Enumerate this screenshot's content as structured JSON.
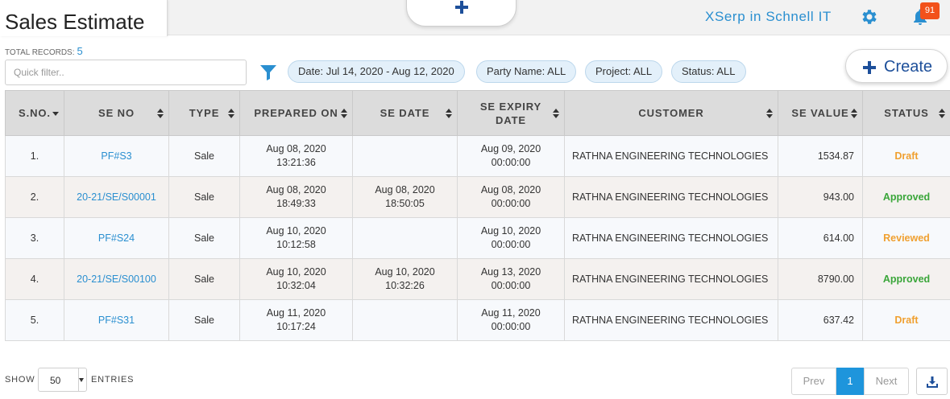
{
  "header": {
    "title": "Sales Estimate",
    "company": "XSerp in Schnell IT",
    "notification_count": "91",
    "accent": "#2a8fd0"
  },
  "toolbar": {
    "total_label": "TOTAL RECORDS:",
    "total_count": "5",
    "quick_filter_placeholder": "Quick filter..",
    "chips": [
      {
        "label": "Date:",
        "value": "Jul 14, 2020 - Aug 12, 2020"
      },
      {
        "label": "Party Name:",
        "value": "ALL"
      },
      {
        "label": "Project:",
        "value": "ALL"
      },
      {
        "label": "Status:",
        "value": "ALL"
      }
    ],
    "create_label": "Create"
  },
  "table": {
    "columns": [
      "S.NO.",
      "SE NO",
      "TYPE",
      "PREPARED ON",
      "SE DATE",
      "SE EXPIRY DATE",
      "CUSTOMER",
      "SE VALUE",
      "STATUS"
    ],
    "rows": [
      {
        "sno": "1.",
        "se_no": "PF#S3",
        "type": "Sale",
        "prepared_date": "Aug 08, 2020",
        "prepared_time": "13:21:36",
        "se_date": "",
        "se_time": "",
        "expiry_date": "Aug 09, 2020",
        "expiry_time": "00:00:00",
        "customer": "RATHNA ENGINEERING TECHNOLOGIES",
        "value": "1534.87",
        "status": "Draft"
      },
      {
        "sno": "2.",
        "se_no": "20-21/SE/S00001",
        "type": "Sale",
        "prepared_date": "Aug 08, 2020",
        "prepared_time": "18:49:33",
        "se_date": "Aug 08, 2020",
        "se_time": "18:50:05",
        "expiry_date": "Aug 08, 2020",
        "expiry_time": "00:00:00",
        "customer": "RATHNA ENGINEERING TECHNOLOGIES",
        "value": "943.00",
        "status": "Approved"
      },
      {
        "sno": "3.",
        "se_no": "PF#S24",
        "type": "Sale",
        "prepared_date": "Aug 10, 2020",
        "prepared_time": "10:12:58",
        "se_date": "",
        "se_time": "",
        "expiry_date": "Aug 10, 2020",
        "expiry_time": "00:00:00",
        "customer": "RATHNA ENGINEERING TECHNOLOGIES",
        "value": "614.00",
        "status": "Reviewed"
      },
      {
        "sno": "4.",
        "se_no": "20-21/SE/S00100",
        "type": "Sale",
        "prepared_date": "Aug 10, 2020",
        "prepared_time": "10:32:04",
        "se_date": "Aug 10, 2020",
        "se_time": "10:32:26",
        "expiry_date": "Aug 13, 2020",
        "expiry_time": "00:00:00",
        "customer": "RATHNA ENGINEERING TECHNOLOGIES",
        "value": "8790.00",
        "status": "Approved"
      },
      {
        "sno": "5.",
        "se_no": "PF#S31",
        "type": "Sale",
        "prepared_date": "Aug 11, 2020",
        "prepared_time": "10:17:24",
        "se_date": "",
        "se_time": "",
        "expiry_date": "Aug 11, 2020",
        "expiry_time": "00:00:00",
        "customer": "RATHNA ENGINEERING TECHNOLOGIES",
        "value": "637.42",
        "status": "Draft"
      }
    ]
  },
  "footer": {
    "show_label": "SHOW",
    "entries_label": "ENTRIES",
    "page_size": "50",
    "prev_label": "Prev",
    "current_page": "1",
    "next_label": "Next"
  }
}
